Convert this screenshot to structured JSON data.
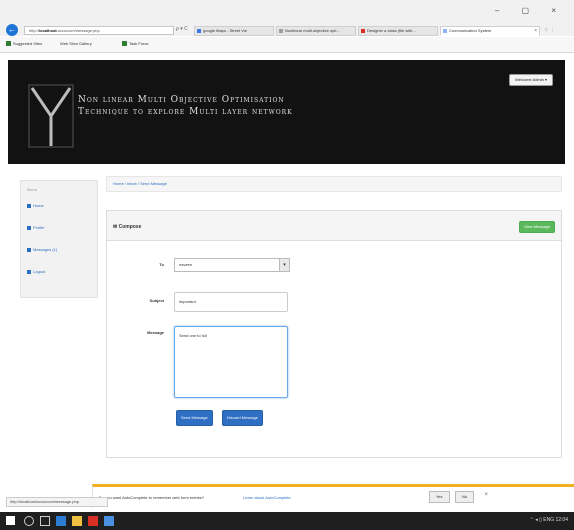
{
  "browser": {
    "back_glyph": "←",
    "url_prefix": "http://",
    "url_host": "localhost",
    "url_rest": "/uccs/com/message.php",
    "addr_tools": "ρ ▾ C",
    "window_controls": "– ▢ ×",
    "new_tab_glyph": "☆ ⋮",
    "tabs": [
      {
        "label": "google Maps - Street Vie",
        "active": false
      },
      {
        "label": "Nonlinear multi-objective opti...",
        "active": false
      },
      {
        "label": "Designer a class (file with...",
        "active": false
      },
      {
        "label": "Communication System",
        "active": true
      }
    ],
    "bookmarks": [
      {
        "label": "Suggested Sites",
        "color": "#2e7d32"
      },
      {
        "label": "Web Slice Gallery",
        "color": "#f0a020"
      },
      {
        "label": "Task Force",
        "color": "#2e7d32"
      }
    ]
  },
  "header": {
    "title_line1": "Non linear Multi Objective Optimisation",
    "title_line2": "Technique to explore Multi layer network",
    "user_button": "Welcome Admin ▾"
  },
  "sidebar": {
    "heading": "Menu",
    "items": [
      {
        "label": "Home",
        "icon": "home-icon"
      },
      {
        "label": "Profile",
        "icon": "user-icon"
      },
      {
        "label": "Messages (1)",
        "icon": "envelope-icon"
      },
      {
        "label": "Logout",
        "icon": "logout-icon"
      }
    ]
  },
  "breadcrumb": "Home / Inbox / Send Message",
  "panel": {
    "title": "✉ Compose",
    "view_button": "View Message"
  },
  "form": {
    "to_label": "To",
    "to_value": "naveen",
    "subject_label": "Subject",
    "subject_value": "important",
    "message_label": "Message",
    "message_value": "Send one to full",
    "send_button": "Send Message",
    "cancel_button": "Discard Message"
  },
  "notification": {
    "text": "Do you want AutoComplete to remember web form entries?",
    "link": "Learn about AutoComplete",
    "yes": "Yes",
    "no": "No",
    "close": "×"
  },
  "statusbar": "http://localhost/uccs/com/message.php",
  "taskbar": {
    "tray": "⌃ ◂ ▯ ENG 12:04"
  },
  "colors": {
    "header_bg": "#121212",
    "primary": "#2e6fc4",
    "success": "#5cb85c",
    "notify_accent": "#f2b01e"
  }
}
